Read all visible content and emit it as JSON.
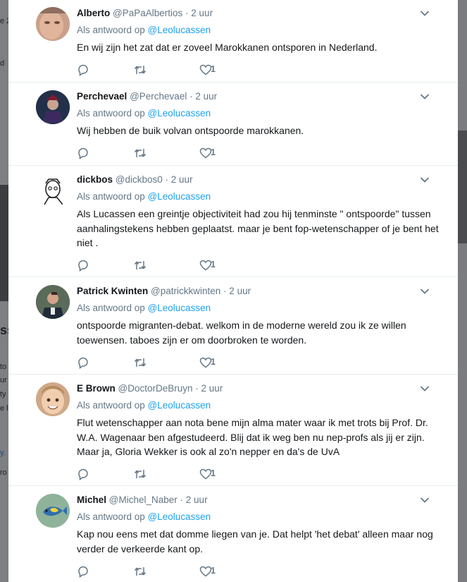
{
  "background": {
    "left_texts": [
      "e 2",
      "d",
      "ss",
      "to",
      "ur",
      "ty",
      "e l",
      "y.",
      "ro"
    ]
  },
  "tweets": [
    {
      "name": "Alberto",
      "handle": "@PaPaAlbertios",
      "time": "· 2 uur",
      "reply_prefix": "Als antwoord op",
      "reply_to": "@Leolucassen",
      "text": "En wij zijn het zat dat er zoveel Marokkanen ontsporen in Nederland.",
      "likes": "1",
      "avatar": "face-avatar"
    },
    {
      "name": "Perchevael",
      "handle": "@Perchevael",
      "time": "· 2 uur",
      "reply_prefix": "Als antwoord op",
      "reply_to": "@Leolucassen",
      "text": "Wij hebben de buik volvan ontspoorde marokkanen.",
      "likes": "1",
      "avatar": "dark-figure-avatar"
    },
    {
      "name": "dickbos",
      "handle": "@dickbos0",
      "time": "· 2 uur",
      "reply_prefix": "Als antwoord op",
      "reply_to": "@Leolucassen",
      "text": "Als Lucassen een greintje objectiviteit had zou hij tenminste \" ontspoorde\" tussen aanhalingstekens hebben geplaatst. maar je bent fop-wetenschapper of je bent het niet .",
      "likes": "1",
      "avatar": "sketch-avatar"
    },
    {
      "name": "Patrick Kwinten",
      "handle": "@patrickkwinten",
      "time": "· 2 uur",
      "reply_prefix": "Als antwoord op",
      "reply_to": "@Leolucassen",
      "text": "ontspoorde migranten-debat. welkom in de moderne wereld zou ik ze willen toewensen. taboes zijn er om doorbroken te worden.",
      "likes": "1",
      "avatar": "photo-avatar"
    },
    {
      "name": "E Brown",
      "handle": "@DoctorDeBruyn",
      "time": "· 2 uur",
      "reply_prefix": "Als antwoord op",
      "reply_to": "@Leolucassen",
      "text": "Flut wetenschapper aan nota bene mijn alma mater waar ik met trots bij Prof. Dr. W.A. Wagenaar ben afgestudeerd. Blij dat ik weg ben nu nep-profs als jij er zijn. Maar ja, Gloria Wekker is ook al zo'n nepper en da's de UvA",
      "likes": "1",
      "avatar": "child-avatar"
    },
    {
      "name": "Michel",
      "handle": "@Michel_Naber",
      "time": "· 2 uur",
      "reply_prefix": "Als antwoord op",
      "reply_to": "@Leolucassen",
      "text": "Kap nou eens met dat domme liegen van je. Dat helpt 'het debat' alleen maar nog verder de verkeerde kant op.",
      "likes": "1",
      "avatar": "fish-avatar"
    }
  ],
  "colors": {
    "link": "#1da1f2",
    "muted": "#657786",
    "text": "#14171a"
  }
}
